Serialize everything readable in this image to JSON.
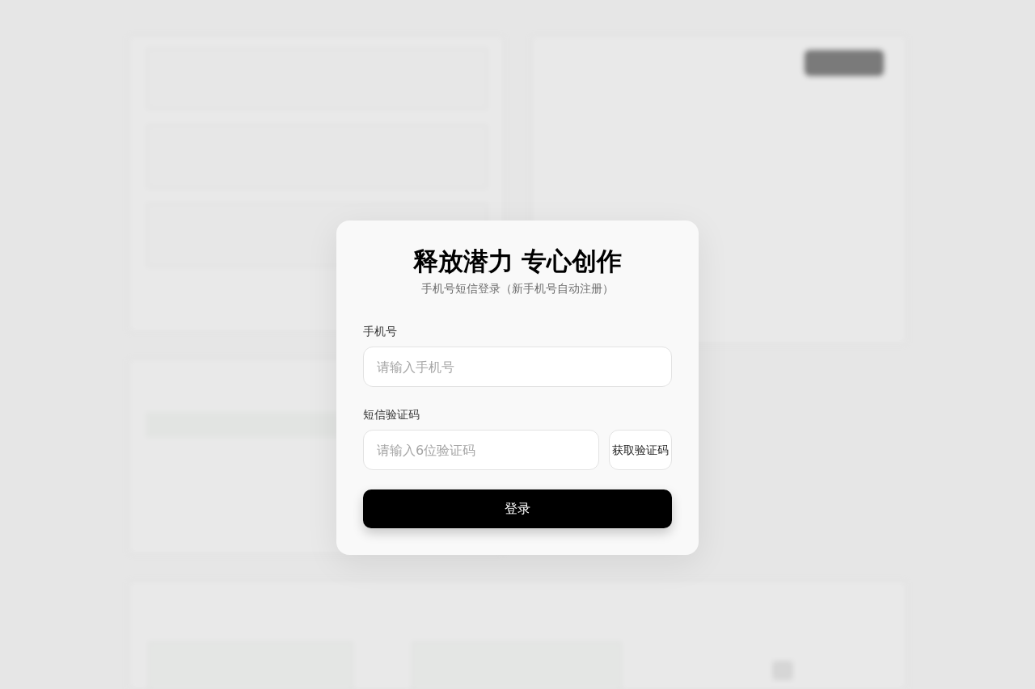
{
  "login_dialog": {
    "title": "释放潜力 专心创作",
    "subtitle": "手机号短信登录（新手机号自动注册）",
    "phone": {
      "label": "手机号",
      "placeholder": "请输入手机号"
    },
    "code": {
      "label": "短信验证码",
      "placeholder": "请输入6位验证码",
      "button": "获取验证码"
    },
    "submit": "登录"
  }
}
